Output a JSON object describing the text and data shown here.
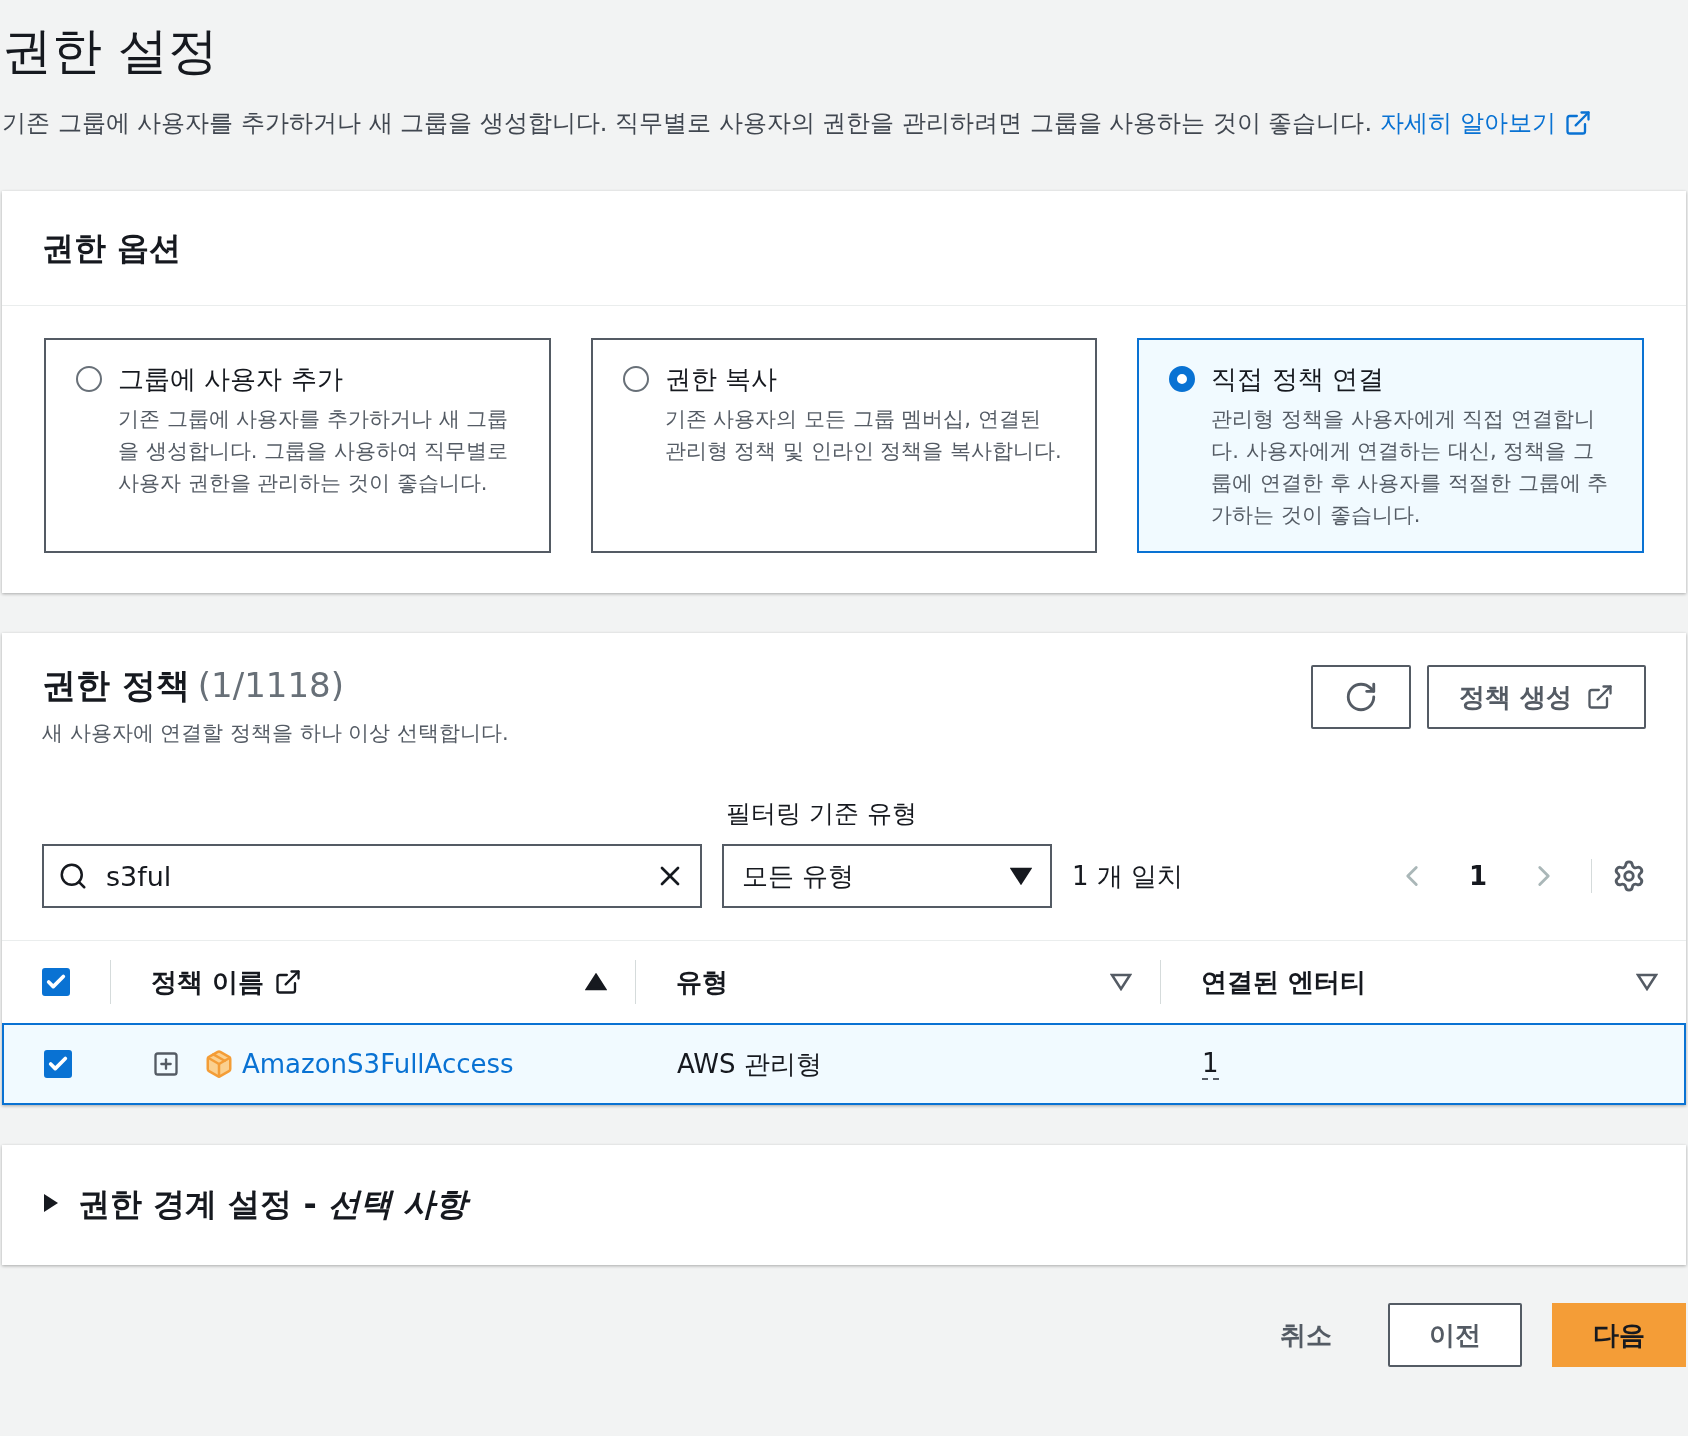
{
  "page": {
    "title": "권한 설정",
    "description": "기존 그룹에 사용자를 추가하거나 새 그룹을 생성합니다. 직무별로 사용자의 권한을 관리하려면 그룹을 사용하는 것이 좋습니다.",
    "learn_more": "자세히 알아보기"
  },
  "options_panel": {
    "title": "권한 옵션",
    "options": [
      {
        "title": "그룹에 사용자 추가",
        "description": "기존 그룹에 사용자를 추가하거나 새 그룹을 생성합니다. 그룹을 사용하여 직무별로 사용자 권한을 관리하는 것이 좋습니다.",
        "selected": false
      },
      {
        "title": "권한 복사",
        "description": "기존 사용자의 모든 그룹 멤버십, 연결된 관리형 정책 및 인라인 정책을 복사합니다.",
        "selected": false
      },
      {
        "title": "직접 정책 연결",
        "description": "관리형 정책을 사용자에게 직접 연결합니다. 사용자에게 연결하는 대신, 정책을 그룹에 연결한 후 사용자를 적절한 그룹에 추가하는 것이 좋습니다.",
        "selected": true
      }
    ]
  },
  "policies_panel": {
    "title": "권한 정책",
    "count": "(1/1118)",
    "subtitle": "새 사용자에 연결할 정책을 하나 이상 선택합니다.",
    "create_button": "정책 생성",
    "search": {
      "value": "s3ful"
    },
    "filter": {
      "label": "필터링 기준 유형",
      "value": "모든 유형"
    },
    "match_count": "1 개 일치",
    "page": "1",
    "header_checked": true,
    "columns": [
      {
        "label": "정책 이름",
        "sorted": true,
        "external": true
      },
      {
        "label": "유형",
        "sorted": false,
        "external": false
      },
      {
        "label": "연결된 엔터티",
        "sorted": false,
        "external": false
      }
    ],
    "rows": [
      {
        "name": "AmazonS3FullAccess",
        "type": "AWS 관리형",
        "entities": "1",
        "checked": true,
        "selected": true
      }
    ]
  },
  "boundary": {
    "title": "권한 경계 설정 - ",
    "optional": "선택 사항",
    "expanded": false
  },
  "footer": {
    "cancel": "취소",
    "previous": "이전",
    "next": "다음"
  }
}
